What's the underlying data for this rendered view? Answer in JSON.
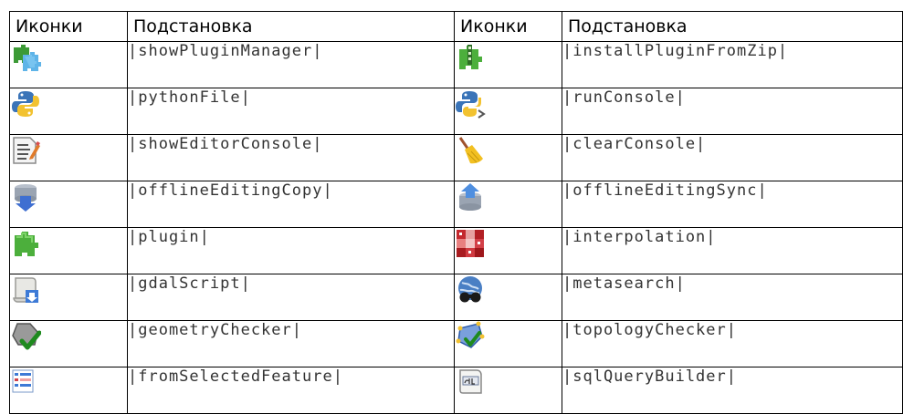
{
  "headers": {
    "icons_left": "Иконки",
    "subst_left": "Подстановка",
    "icons_right": "Иконки",
    "subst_right": "Подстановка"
  },
  "rows": [
    {
      "left": {
        "icon": "plugin-manager-icon",
        "text": "|showPluginManager|"
      },
      "right": {
        "icon": "install-plugin-zip-icon",
        "text": "|installPluginFromZip|"
      }
    },
    {
      "left": {
        "icon": "python-file-icon",
        "text": "|pythonFile|"
      },
      "right": {
        "icon": "run-console-icon",
        "text": "|runConsole|"
      }
    },
    {
      "left": {
        "icon": "editor-console-icon",
        "text": "|showEditorConsole|"
      },
      "right": {
        "icon": "broom-icon",
        "text": "|clearConsole|"
      }
    },
    {
      "left": {
        "icon": "offline-copy-icon",
        "text": "|offlineEditingCopy|"
      },
      "right": {
        "icon": "offline-sync-icon",
        "text": "|offlineEditingSync|"
      }
    },
    {
      "left": {
        "icon": "plugin-icon",
        "text": "|plugin|"
      },
      "right": {
        "icon": "interpolation-icon",
        "text": "|interpolation|"
      }
    },
    {
      "left": {
        "icon": "gdal-script-icon",
        "text": "|gdalScript|"
      },
      "right": {
        "icon": "metasearch-icon",
        "text": "|metasearch|"
      }
    },
    {
      "left": {
        "icon": "geometry-checker-icon",
        "text": "|geometryChecker|"
      },
      "right": {
        "icon": "topology-checker-icon",
        "text": "|topologyChecker|"
      }
    },
    {
      "left": {
        "icon": "selected-feature-icon",
        "text": "|fromSelectedFeature|"
      },
      "right": {
        "icon": "sql-query-builder-icon",
        "text": "|sqlQueryBuilder|"
      }
    }
  ]
}
